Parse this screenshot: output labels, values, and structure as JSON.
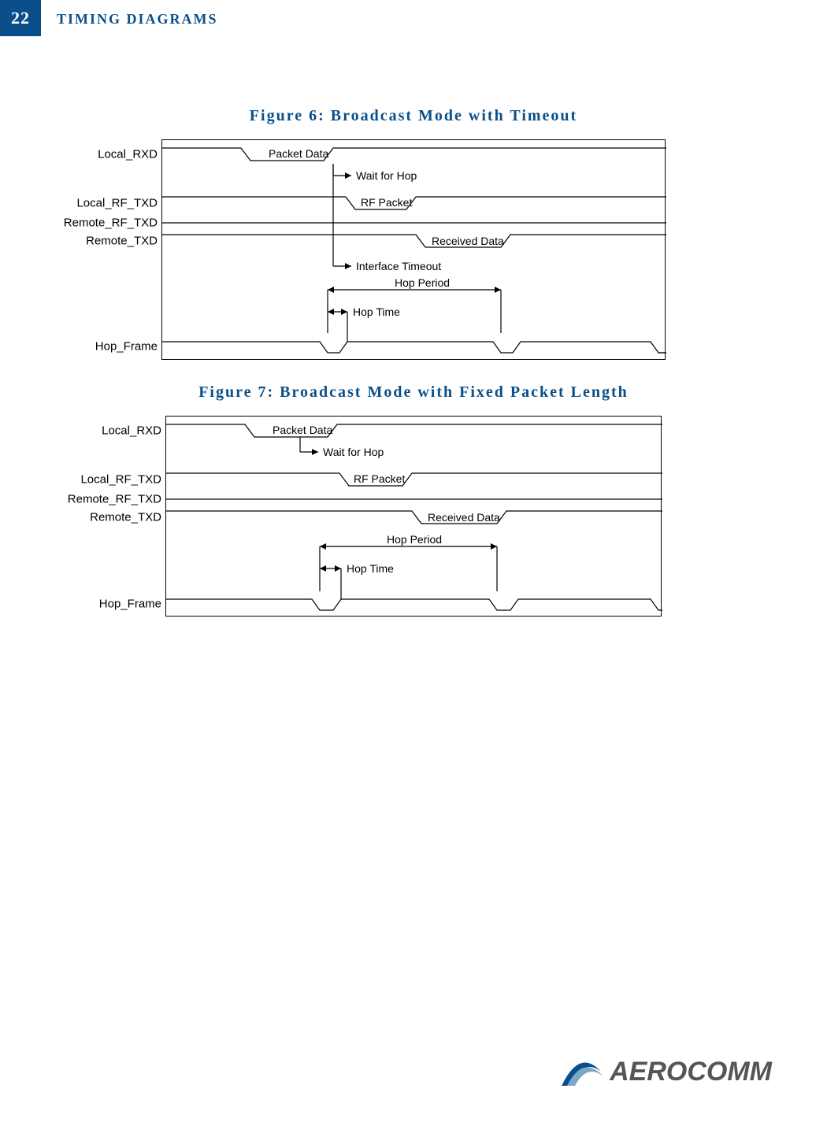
{
  "page_number": "22",
  "section_title": "TIMING DIAGRAMS",
  "figure6": {
    "title": "Figure 6: Broadcast Mode with Timeout",
    "signals": {
      "local_rxd": "Local_RXD",
      "local_rf_txd": "Local_RF_TXD",
      "remote_rf_txd": "Remote_RF_TXD",
      "remote_txd": "Remote_TXD",
      "hop_frame": "Hop_Frame"
    },
    "annotations": {
      "packet_data": "Packet Data",
      "wait_for_hop": "Wait for Hop",
      "rf_packet": "RF Packet",
      "received_data": "Received Data",
      "interface_timeout": "Interface Timeout",
      "hop_period": "Hop Period",
      "hop_time": "Hop Time"
    }
  },
  "figure7": {
    "title": "Figure 7: Broadcast Mode with Fixed Packet Length",
    "signals": {
      "local_rxd": "Local_RXD",
      "local_rf_txd": "Local_RF_TXD",
      "remote_rf_txd": "Remote_RF_TXD",
      "remote_txd": "Remote_TXD",
      "hop_frame": "Hop_Frame"
    },
    "annotations": {
      "packet_data": "Packet Data",
      "wait_for_hop": "Wait for Hop",
      "rf_packet": "RF Packet",
      "received_data": "Received Data",
      "hop_period": "Hop Period",
      "hop_time": "Hop Time"
    }
  },
  "footer_brand": "AEROCOMM"
}
